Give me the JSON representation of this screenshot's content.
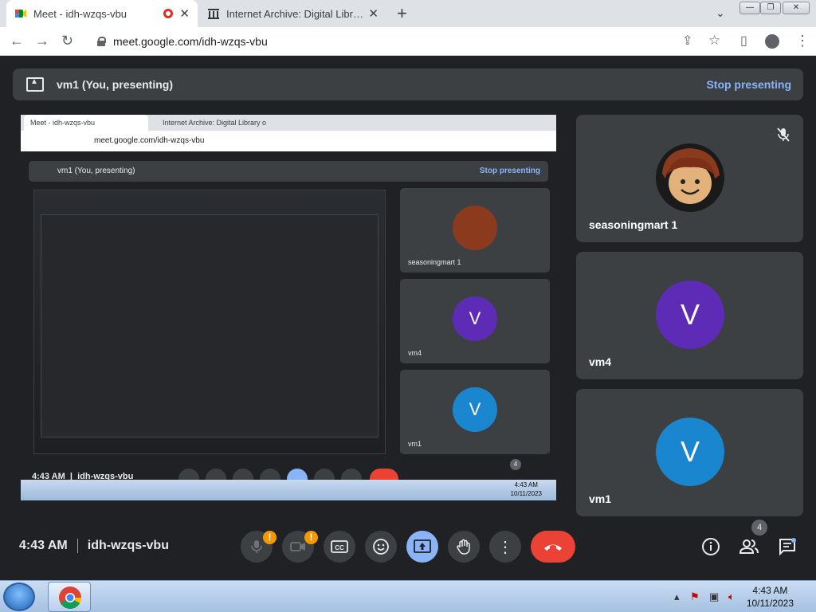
{
  "browser": {
    "tabs": [
      {
        "title": "Meet - idh-wzqs-vbu",
        "active": true
      },
      {
        "title": "Internet Archive: Digital Library o",
        "active": false
      }
    ],
    "url": "meet.google.com/idh-wzqs-vbu"
  },
  "meet": {
    "presenting_label": "vm1 (You, presenting)",
    "stop_presenting": "Stop presenting",
    "shared_screen": {
      "tab1": "Meet - idh-wzqs-vbu",
      "tab2": "Internet Archive: Digital Library o",
      "url": "meet.google.com/idh-wzqs-vbu",
      "presenting_label": "vm1 (You, presenting)",
      "stop_presenting": "Stop presenting",
      "participants": [
        {
          "name": "seasoningmart 1",
          "initial": ""
        },
        {
          "name": "vm4",
          "initial": "V"
        },
        {
          "name": "vm1",
          "initial": "V"
        }
      ],
      "time": "4:43 AM",
      "code": "idh-wzqs-vbu",
      "participant_count": "4",
      "clock_time": "4:43 AM",
      "clock_date": "10/11/2023"
    },
    "participants": [
      {
        "name": "seasoningmart 1",
        "initial": "",
        "avatar_color": "#3c4043"
      },
      {
        "name": "vm4",
        "initial": "V",
        "avatar_color": "#5e2bb6"
      },
      {
        "name": "vm1",
        "initial": "V",
        "avatar_color": "#1a86d0"
      }
    ],
    "controls": {
      "time": "4:43 AM",
      "meeting_code": "idh-wzqs-vbu",
      "participant_count": "4",
      "icons": [
        "mic-off-icon",
        "camera-off-icon",
        "captions-icon",
        "emoji-icon",
        "present-icon",
        "raise-hand-icon",
        "more-options-icon",
        "leave-call-icon",
        "info-icon",
        "people-icon",
        "chat-icon"
      ]
    },
    "colors": {
      "accent": "#8ab4f8",
      "leave": "#ea4335",
      "warning": "#f29900",
      "background": "#202124",
      "tile": "#3c4043"
    }
  },
  "taskbar": {
    "time": "4:43 AM",
    "date": "10/11/2023"
  }
}
